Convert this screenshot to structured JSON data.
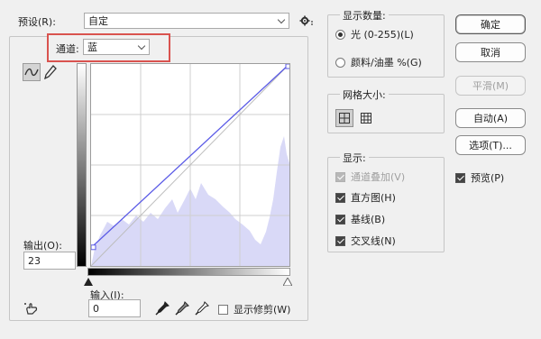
{
  "preset": {
    "label": "预设(R):",
    "value": "自定"
  },
  "channel": {
    "label": "通道:",
    "value": "蓝"
  },
  "output": {
    "label": "输出(O):",
    "value": "23"
  },
  "input": {
    "label": "输入(I):",
    "value": "0"
  },
  "show_clipping": {
    "label": "显示修剪(W)",
    "checked": false
  },
  "display_amount": {
    "title": "显示数量:",
    "options": [
      {
        "label": "光 (0-255)(L)",
        "selected": true
      },
      {
        "label": "颜料/油墨 %(G)",
        "selected": false
      }
    ]
  },
  "grid_size": {
    "title": "网格大小:"
  },
  "show": {
    "title": "显示:",
    "items": [
      {
        "label": "通道叠加(V)",
        "checked": true,
        "disabled": true
      },
      {
        "label": "直方图(H)",
        "checked": true,
        "disabled": false
      },
      {
        "label": "基线(B)",
        "checked": true,
        "disabled": false
      },
      {
        "label": "交叉线(N)",
        "checked": true,
        "disabled": false
      }
    ]
  },
  "buttons": {
    "ok": "确定",
    "cancel": "取消",
    "smooth": "平滑(M)",
    "auto": "自动(A)",
    "options": "选项(T)..."
  },
  "preview": {
    "label": "预览(P)",
    "checked": true
  },
  "colors": {
    "curve": "#5a5ae6",
    "histogram": "#d9d9f7",
    "highlight_box": "#d9534f"
  },
  "curve": {
    "start": [
      0,
      23
    ],
    "end": [
      255,
      255
    ]
  }
}
